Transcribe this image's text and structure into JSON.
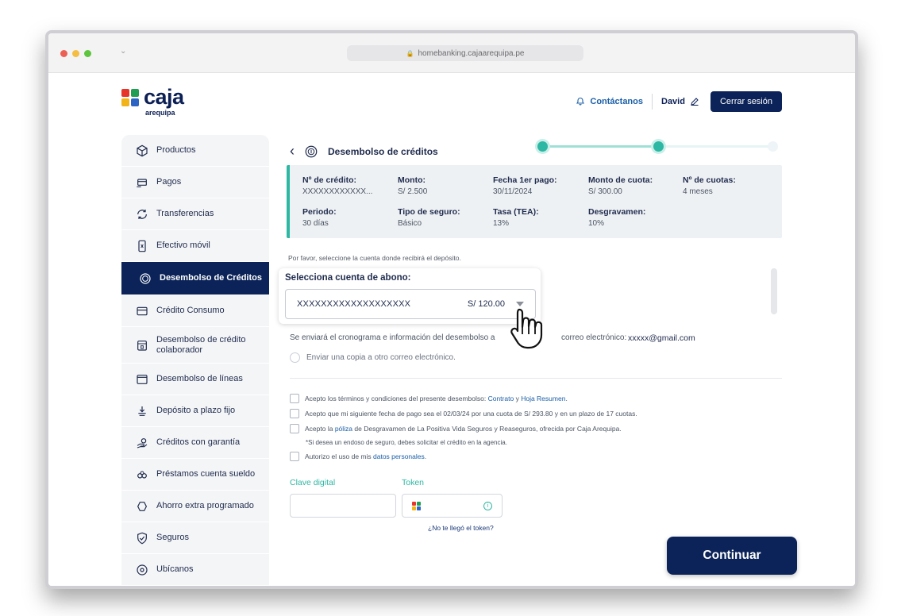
{
  "browser": {
    "url": "homebanking.cajaarequipa.pe"
  },
  "logo": {
    "name": "caja",
    "sub": "arequipa"
  },
  "header": {
    "contact": "Contáctanos",
    "user": "David",
    "logout": "Cerrar sesión"
  },
  "sidebar": {
    "items": [
      {
        "label": "Productos",
        "icon": "box-icon"
      },
      {
        "label": "Pagos",
        "icon": "payment-icon"
      },
      {
        "label": "Transferencias",
        "icon": "transfer-icon"
      },
      {
        "label": "Efectivo móvil",
        "icon": "mobile-cash-icon"
      },
      {
        "label": "Desembolso de Créditos",
        "icon": "coin-icon",
        "active": true
      },
      {
        "label": "Crédito Consumo",
        "icon": "card-icon"
      },
      {
        "label": "Desembolso de crédito colaborador",
        "icon": "collaborator-icon"
      },
      {
        "label": "Desembolso de líneas",
        "icon": "wallet-icon"
      },
      {
        "label": "Depósito a plazo fijo",
        "icon": "deposit-icon"
      },
      {
        "label": "Créditos con garantía",
        "icon": "guarantee-icon"
      },
      {
        "label": "Préstamos cuenta sueldo",
        "icon": "salary-icon"
      },
      {
        "label": "Ahorro extra programado",
        "icon": "savings-icon"
      },
      {
        "label": "Seguros",
        "icon": "shield-icon"
      },
      {
        "label": "Ubícanos",
        "icon": "location-icon"
      }
    ]
  },
  "main": {
    "title": "Desembolso de créditos",
    "summary": {
      "credit_number": {
        "label": "Nº de crédito:",
        "value": "XXXXXXXXXXXX..."
      },
      "amount": {
        "label": "Monto:",
        "value": "S/ 2.500"
      },
      "first_payment": {
        "label": "Fecha 1er pago:",
        "value": "30/11/2024"
      },
      "installment": {
        "label": "Monto de cuota:",
        "value": "S/ 300.00"
      },
      "installments": {
        "label": "Nº de cuotas:",
        "value": "4 meses"
      },
      "period": {
        "label": "Periodo:",
        "value": "30 días"
      },
      "insurance_type": {
        "label": "Tipo de seguro:",
        "value": "Básico"
      },
      "rate": {
        "label": "Tasa (TEA):",
        "value": "13%"
      },
      "desgravamen": {
        "label": "Desgravamen:",
        "value": "10%"
      }
    },
    "instruction": "Por favor, seleccione la cuenta donde recibirá el depósito.",
    "account": {
      "title": "Selecciona cuenta de abono:",
      "number": "XXXXXXXXXXXXXXXXXXX",
      "amount": "S/ 120.00"
    },
    "email": {
      "text_before": "Se enviará el cronograma e información del desembolso a",
      "text_after": "correo electrónico:",
      "value": "xxxxx@gmail.com"
    },
    "copy_option": "Enviar una copia a otro correo electrónico.",
    "checks": {
      "terms_prefix": "Acepto los términos y condiciones del presente desembolso:",
      "terms_link1": "Contrato",
      "terms_y": "y",
      "terms_link2": "Hoja Resumen",
      "terms_end": ".",
      "payment_date": "Acepto que mi siguiente fecha de pago sea el 02/03/24 por una cuota de S/ 293.80 y en un plazo de 17 cuotas.",
      "policy_prefix": "Acepto la",
      "policy_link": "póliza",
      "policy_suffix": "de Desgravamen de La Positiva Vida Seguros y Reaseguros, ofrecida por Caja Arequipa.",
      "note": "*Si desea un endoso de seguro, debes solicitar el crédito en la agencia.",
      "data_prefix": "Autorizo el uso de mis",
      "data_link": "datos personales",
      "data_end": "."
    },
    "fields": {
      "digital_key": "Clave digital",
      "token": "Token",
      "token_help": "¿No te llegó el token?"
    },
    "continue": "Continuar"
  },
  "colors": {
    "navy": "#0b2358",
    "teal": "#2eb7a3",
    "link": "#1b5fa8"
  }
}
